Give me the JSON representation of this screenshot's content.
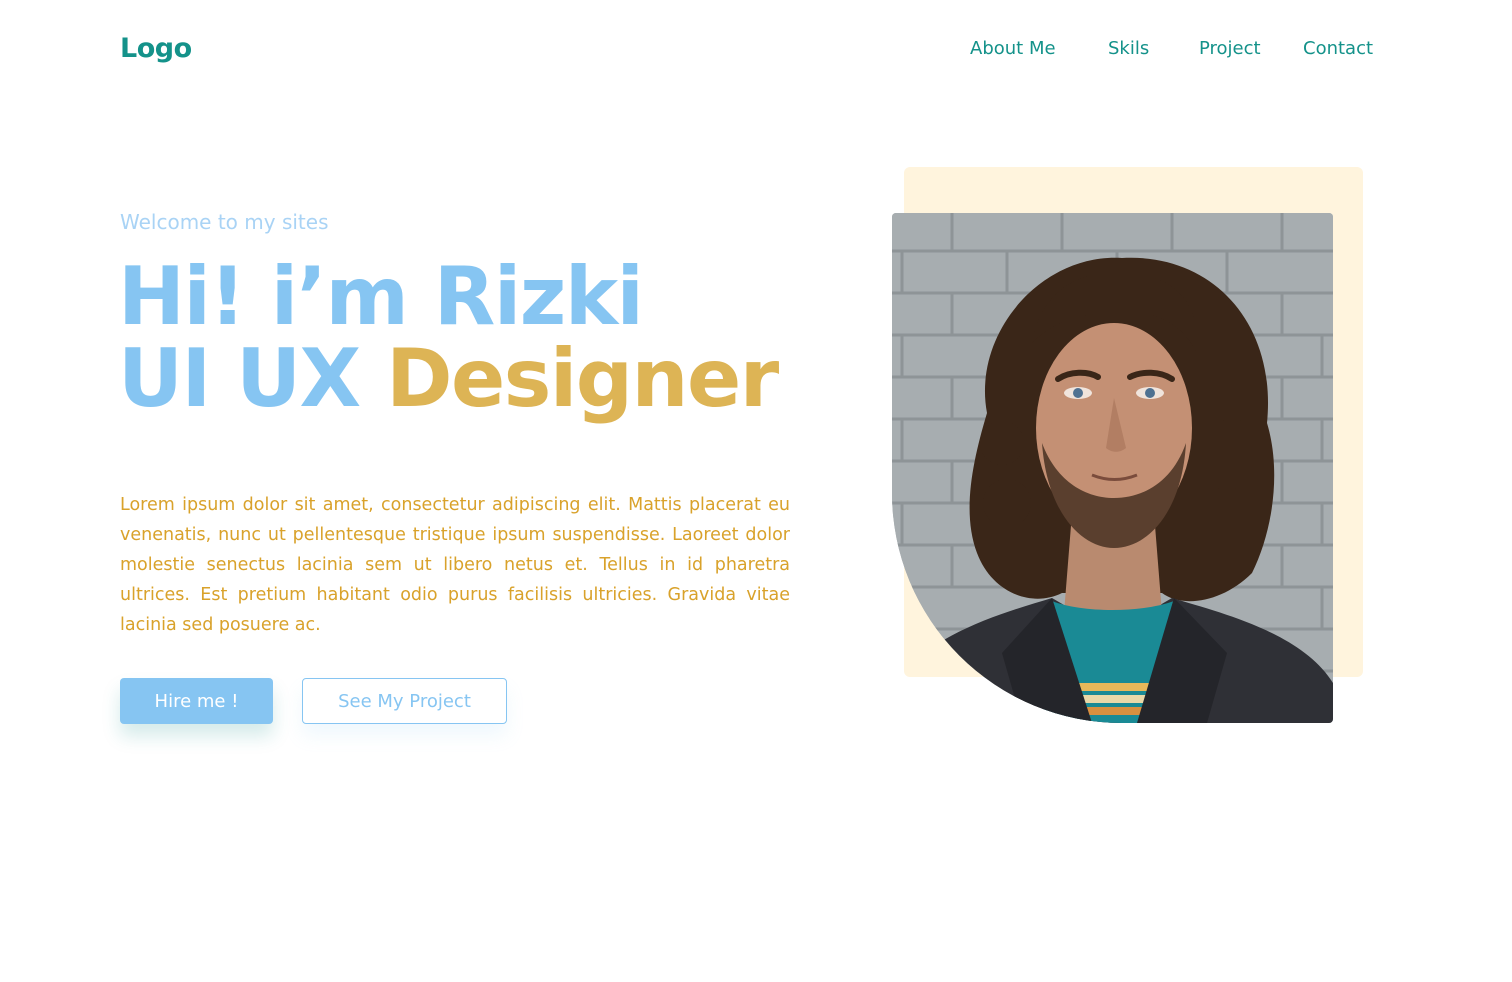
{
  "header": {
    "logo": "Logo",
    "nav": [
      "About Me",
      "Skils",
      "Project",
      "Contact"
    ]
  },
  "hero": {
    "welcome": "Welcome to my sites",
    "title_line1": "Hi! i’m Rizki",
    "title_line2_blue": "UI UX",
    "title_line2_gold": "Designer",
    "description": "Lorem ipsum dolor sit amet, consectetur adipiscing elit. Mattis placerat eu venenatis, nunc ut pellentesque tristique ipsum suspendisse. Laoreet dolor molestie senectus lacinia sem ut libero netus et. Tellus in id pharetra ultrices. Est pretium habitant odio purus facilisis ultricies. Gravida vitae lacinia sed posuere ac.",
    "hire_button": "Hire me !",
    "project_button": "See My Project"
  },
  "colors": {
    "brand_teal": "#14928a",
    "accent_blue": "#86c5f2",
    "accent_gold": "#ddb455",
    "text_gold": "#d9a22b",
    "photo_backdrop": "#fff4dd"
  },
  "photo": {
    "subject": "portrait-photo"
  }
}
